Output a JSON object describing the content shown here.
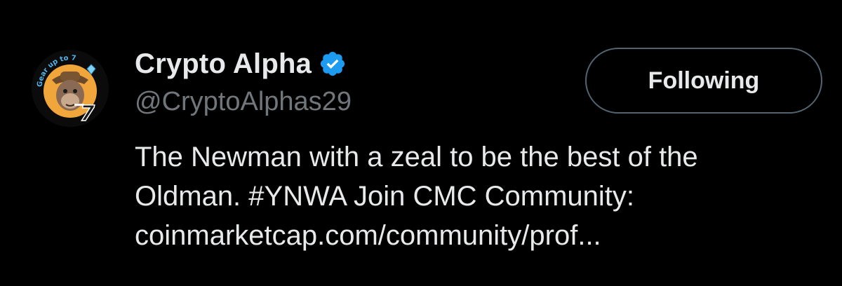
{
  "profile": {
    "display_name": "Crypto Alpha",
    "handle": "@CryptoAlphas29",
    "verified_icon": "verified-badge-icon",
    "avatar": {
      "icon": "cartoon-ape-avatar",
      "ring_text": "Gear up to 7",
      "ring_number": "7"
    }
  },
  "actions": {
    "follow_label": "Following"
  },
  "bio": {
    "line1": "The Newman with a zeal to be the best of the",
    "line2": "Oldman. #YNWA Join CMC Community:",
    "line3": "coinmarketcap.com/community/prof..."
  },
  "colors": {
    "background": "#000000",
    "text_primary": "#e7e9ea",
    "text_secondary": "#71767b",
    "button_border": "#536471",
    "verified_blue": "#1d9bf0"
  }
}
